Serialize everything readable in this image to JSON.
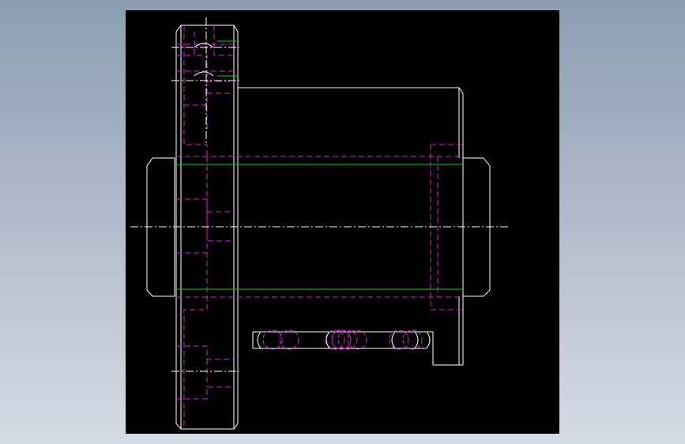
{
  "viewport": {
    "background_top": "#8d9db2",
    "background_bottom": "#d6dbe3"
  },
  "drawing": {
    "canvas_color": "#000000",
    "colors": {
      "visible": "#ffffff",
      "hidden": "#e01cdf",
      "center": "#ffffff",
      "tangent": "#00d200"
    },
    "views": [
      "side-view-flange",
      "section-view-nut-body"
    ]
  }
}
